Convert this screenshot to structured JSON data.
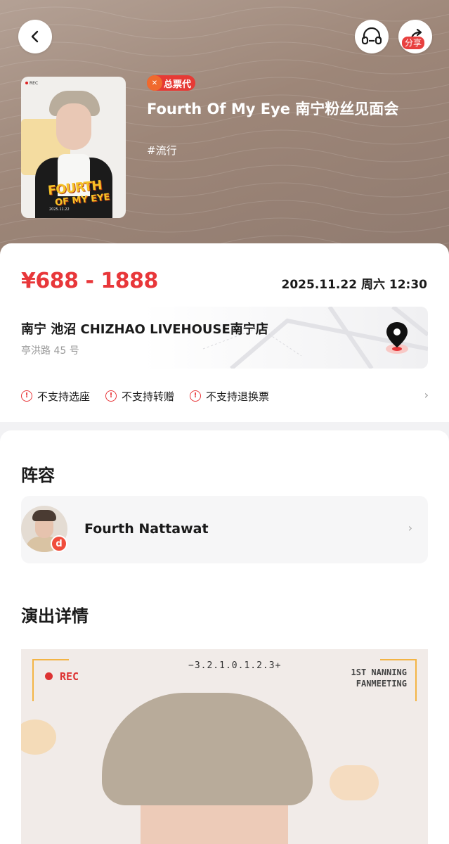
{
  "header": {
    "share_label": "分享",
    "badge_label": "总票代",
    "badge_dot": "✕",
    "title": "Fourth Of My Eye 南宁粉丝见面会",
    "tag": "#流行"
  },
  "poster": {
    "rec": "REC",
    "logo_line1": "FOURTH",
    "logo_line2": "OF MY EYE",
    "date": "2025.11.22"
  },
  "info": {
    "price": "¥688 - 1888",
    "datetime": "2025.11.22 周六 12:30",
    "venue_name": "南宁 池沼 CHIZHAO LIVEHOUSE南宁店",
    "venue_address": "亭洪路 45 号",
    "notices": [
      "不支持选座",
      "不支持转赠",
      "不支持退换票"
    ]
  },
  "lineup": {
    "title": "阵容",
    "artist_name": "Fourth Nattawat",
    "artist_badge": "d"
  },
  "details": {
    "title": "演出详情",
    "rec": "REC",
    "scale": "−3.2.1.0.1.2.3+",
    "info_line1": "1ST NANNING",
    "info_line2": "FANMEETING"
  },
  "colors": {
    "accent": "#e8373a",
    "hero_bg": "#9d8678"
  },
  "icons": {
    "back": "chevron-left-icon",
    "listen": "headphones-icon",
    "share": "share-icon",
    "map": "location-pin-icon",
    "warning": "exclamation-circle-icon",
    "arrow": "chevron-right-icon"
  }
}
